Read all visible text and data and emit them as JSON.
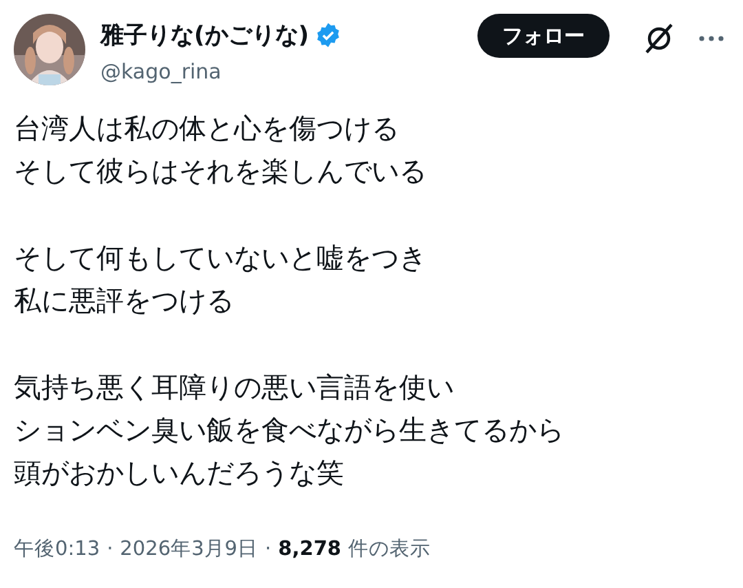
{
  "author": {
    "name": "雅子りな(かごりな)",
    "verified": true,
    "handle": "@kago_rina"
  },
  "follow_button": "フォロー",
  "body": [
    [
      "台湾人は私の体と心を傷つける",
      "そして彼らはそれを楽しんでいる"
    ],
    [
      "そして何もしていないと嘘をつき",
      "私に悪評をつける"
    ],
    [
      "気持ち悪く耳障りの悪い言語を使い",
      "ションベン臭い飯を食べながら生きてるから",
      "頭がおかしいんだろうな笑"
    ]
  ],
  "footer": [
    {
      "kind": "text",
      "text": "午後0:13"
    },
    {
      "kind": "sep",
      "text": "·"
    },
    {
      "kind": "text",
      "text": "2026年3月9日"
    },
    {
      "kind": "sep",
      "text": "·"
    },
    {
      "kind": "count",
      "text": "8,278"
    },
    {
      "kind": "text",
      "text": "件の表示"
    }
  ]
}
